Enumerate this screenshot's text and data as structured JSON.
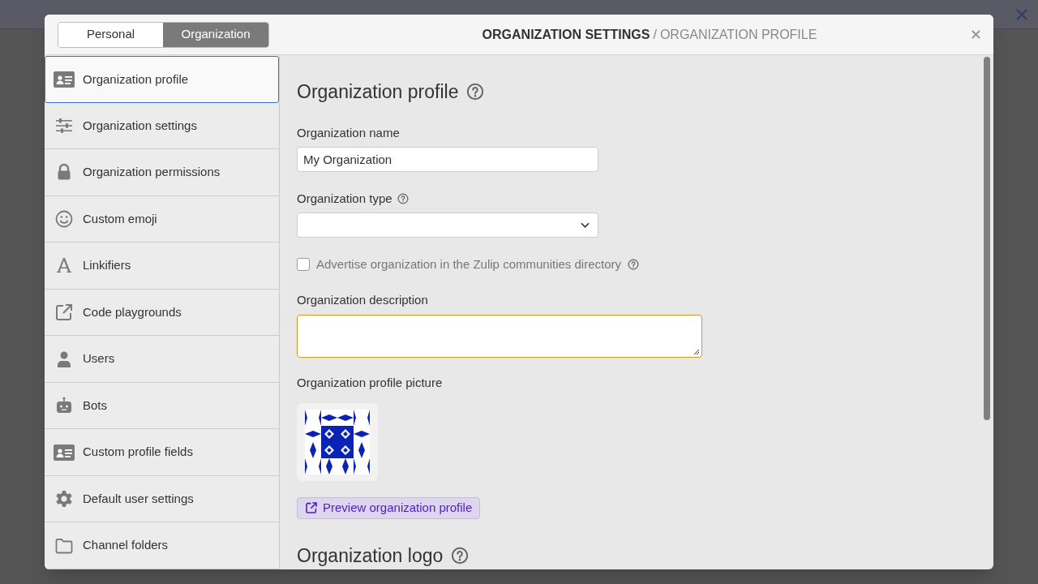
{
  "tabs": [
    {
      "label": "Personal",
      "selected": false
    },
    {
      "label": "Organization",
      "selected": true
    }
  ],
  "header": {
    "title": "ORGANIZATION SETTINGS",
    "separator": "/",
    "subtitle": "ORGANIZATION PROFILE"
  },
  "nav": [
    {
      "label": "Organization profile",
      "selected": true
    },
    {
      "label": "Organization settings",
      "selected": false
    },
    {
      "label": "Organization permissions",
      "selected": false
    },
    {
      "label": "Custom emoji",
      "selected": false
    },
    {
      "label": "Linkifiers",
      "selected": false
    },
    {
      "label": "Code playgrounds",
      "selected": false
    },
    {
      "label": "Users",
      "selected": false
    },
    {
      "label": "Bots",
      "selected": false
    },
    {
      "label": "Custom profile fields",
      "selected": false
    },
    {
      "label": "Default user settings",
      "selected": false
    },
    {
      "label": "Channel folders",
      "selected": false
    }
  ],
  "content": {
    "heading": "Organization profile",
    "name_label": "Organization name",
    "name_value": "My Organization",
    "type_label": "Organization type",
    "advertise": {
      "label": "Advertise organization in the Zulip communities directory",
      "checked": false
    },
    "description_label": "Organization description",
    "picture_label": "Organization profile picture",
    "preview_button": "Preview organization profile",
    "logo_heading": "Organization logo"
  }
}
